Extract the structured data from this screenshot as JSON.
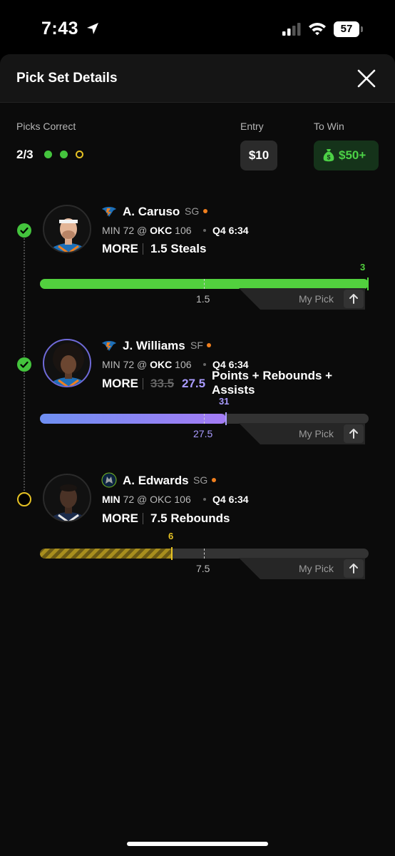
{
  "status_bar": {
    "time": "7:43",
    "battery": "57",
    "icons": [
      "location-arrow-icon",
      "signal-icon",
      "wifi-icon",
      "battery-icon"
    ]
  },
  "header": {
    "title": "Pick Set Details",
    "close_icon": "close-icon"
  },
  "summary": {
    "picks_correct_label": "Picks Correct",
    "picks_correct_value": "2/3",
    "pick_results": [
      "correct",
      "correct",
      "pending"
    ],
    "entry_label": "Entry",
    "entry_value": "$10",
    "to_win_label": "To Win",
    "to_win_value": "$50+",
    "to_win_icon": "money-bag-icon"
  },
  "picks": [
    {
      "status": "correct",
      "team_logo": "okc-thunder-logo",
      "name": "A. Caruso",
      "position": "SG",
      "game": {
        "team1": "MIN",
        "score1": "72",
        "at": "@",
        "team2": "OKC",
        "score2": "106",
        "clock": "Q4 6:34"
      },
      "direction": "MORE",
      "line": "1.5",
      "stat": "Steals",
      "stat_text": "1.5 Steals",
      "current": "3",
      "progress": 1.0,
      "line_fraction": 0.5,
      "bar_color": "#52d13e",
      "value_color": "#52d13e",
      "my_pick_label": "My Pick"
    },
    {
      "status": "correct",
      "team_logo": "okc-thunder-logo",
      "name": "J. Williams",
      "position": "SF",
      "game": {
        "team1": "MIN",
        "score1": "72",
        "at": "@",
        "team2": "OKC",
        "score2": "106",
        "clock": "Q4 6:34"
      },
      "direction": "MORE",
      "old_line": "33.5",
      "line": "27.5",
      "stat": "Points + Rebounds + Assists",
      "current": "31",
      "progress": 0.56,
      "line_fraction": 0.5,
      "bar_color": "#9b8cff",
      "value_color": "#a99bff",
      "my_pick_label": "My Pick"
    },
    {
      "status": "pending",
      "team_logo": "min-timberwolves-logo",
      "name": "A. Edwards",
      "position": "SG",
      "game": {
        "team1": "MIN",
        "score1": "72",
        "at": "@",
        "team2": "OKC",
        "score2": "106",
        "clock": "Q4 6:34"
      },
      "direction": "MORE",
      "line": "7.5",
      "stat": "Rebounds",
      "stat_text": "7.5 Rebounds",
      "current": "6",
      "progress": 0.4,
      "line_fraction": 0.5,
      "bar_color": "#8a7418",
      "value_color": "#e6c224",
      "my_pick_label": "My Pick"
    }
  ]
}
